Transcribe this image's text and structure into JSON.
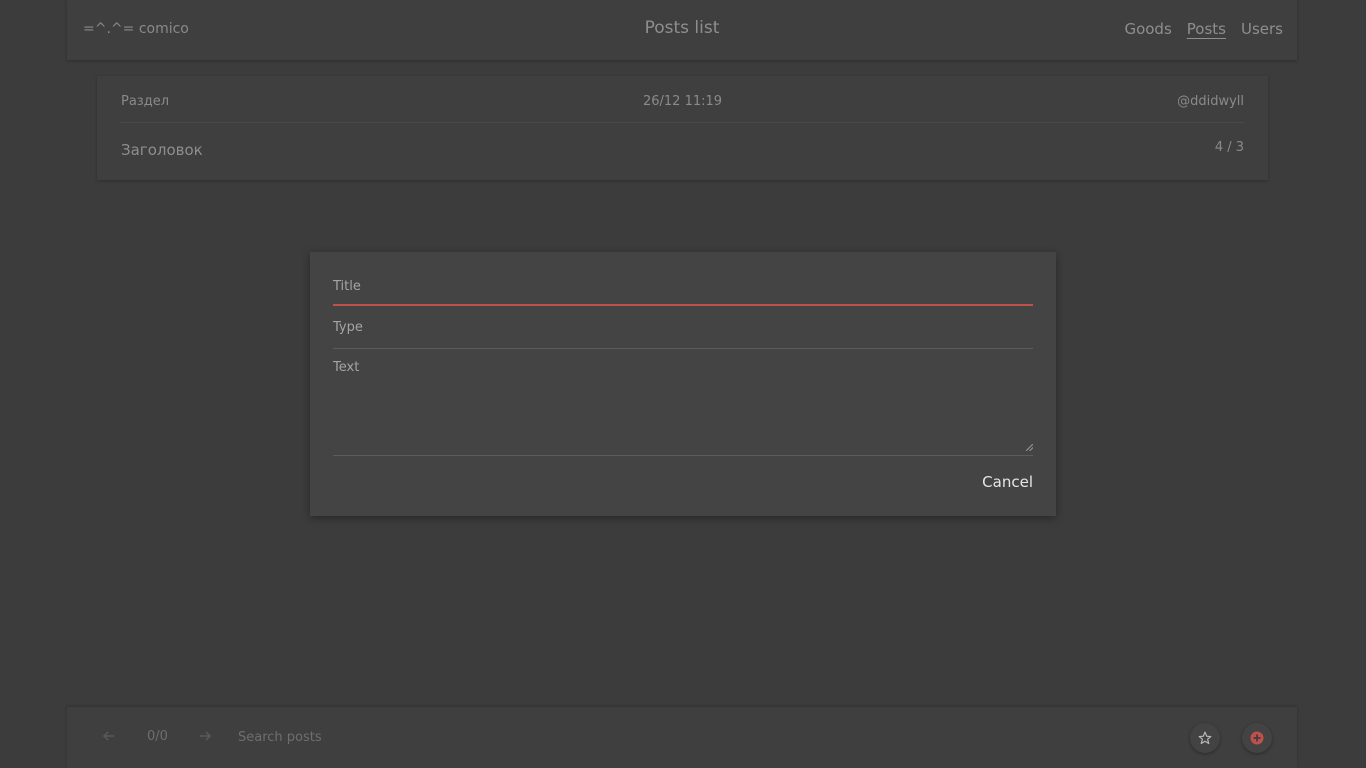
{
  "header": {
    "logo": "=^.^= comico",
    "title": "Posts list",
    "nav": [
      {
        "label": "Goods",
        "active": false
      },
      {
        "label": "Posts",
        "active": true
      },
      {
        "label": "Users",
        "active": false
      }
    ]
  },
  "post": {
    "section": "Раздел",
    "date": "26/12 11:19",
    "author": "@ddidwyll",
    "heading": "Заголовок",
    "count": "4 / 3"
  },
  "dialog": {
    "title_label": "Title",
    "title_value": "",
    "type_label": "Type",
    "type_value": "",
    "text_label": "Text",
    "text_value": "",
    "cancel_label": "Cancel",
    "accent_color": "#c0504a"
  },
  "bottom_bar": {
    "prev_icon": "arrow-left-icon",
    "pager": "0/0",
    "next_icon": "arrow-right-icon",
    "search_placeholder": "Search posts",
    "star_icon": "star-icon",
    "add_icon": "add-circle-icon",
    "add_color": "#c0504a"
  }
}
